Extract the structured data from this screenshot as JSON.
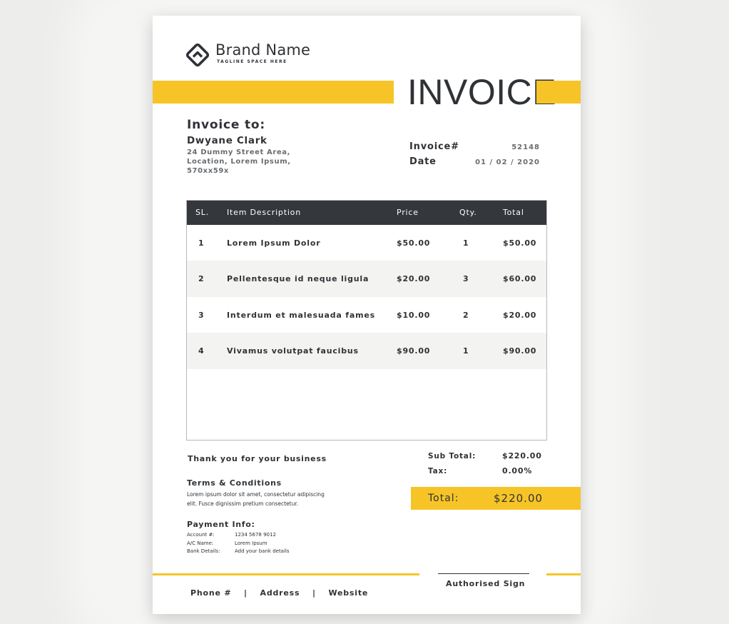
{
  "brand": {
    "name": "Brand Name",
    "tagline": "TAGLINE SPACE HERE",
    "icon": "diamond-house-logo-icon"
  },
  "title": "INVOICE",
  "invoice_to": {
    "heading": "Invoice to:",
    "name": "Dwyane Clark",
    "address_lines": [
      "24 Dummy Street Area,",
      "Location, Lorem Ipsum,",
      "570xx59x"
    ]
  },
  "meta": {
    "invoice_label": "Invoice#",
    "invoice_value": "52148",
    "date_label": "Date",
    "date_value": "01 / 02 / 2020"
  },
  "table": {
    "headers": [
      "SL.",
      "Item Description",
      "Price",
      "Qty.",
      "Total"
    ],
    "rows": [
      [
        "1",
        "Lorem Ipsum Dolor",
        "$50.00",
        "1",
        "$50.00"
      ],
      [
        "2",
        "Pellentesque id neque ligula",
        "$20.00",
        "3",
        "$60.00"
      ],
      [
        "3",
        "Interdum et malesuada fames",
        "$10.00",
        "2",
        "$20.00"
      ],
      [
        "4",
        "Vivamus volutpat faucibus",
        "$90.00",
        "1",
        "$90.00"
      ]
    ]
  },
  "thanks": "Thank you for your business",
  "summary": {
    "subtotal_label": "Sub Total:",
    "subtotal_value": "$220.00",
    "tax_label": "Tax:",
    "tax_value": "0.00%",
    "total_label": "Total:",
    "total_value": "$220.00"
  },
  "terms": {
    "heading": "Terms & Conditions",
    "lines": [
      "Lorem ipsum dolor sit amet, consectetur adipiscing",
      "elit. Fusce dignissim pretium consectetur."
    ]
  },
  "payment": {
    "heading": "Payment Info:",
    "rows": [
      {
        "label": "Account #:",
        "value": "1234 5678 9012"
      },
      {
        "label": "A/C Name:",
        "value": "Lorem Ipsum"
      },
      {
        "label": "Bank Details:",
        "value": "Add your bank details"
      }
    ]
  },
  "sign": "Authorised Sign",
  "footer": {
    "phone": "Phone #",
    "address": "Address",
    "website": "Website",
    "separator": "|"
  },
  "colors": {
    "accent": "#f7c427",
    "dark": "#34373b",
    "row_alt": "#f3f3f1",
    "text": "#2f3236"
  }
}
